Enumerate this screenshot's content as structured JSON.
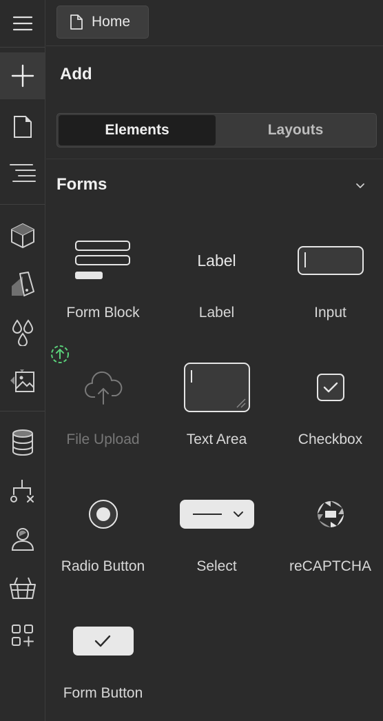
{
  "topbar": {
    "page_label": "Home"
  },
  "panel": {
    "title": "Add",
    "tabs": [
      {
        "label": "Elements",
        "active": true
      },
      {
        "label": "Layouts",
        "active": false
      }
    ],
    "section": {
      "title": "Forms",
      "expanded": true
    }
  },
  "elements": [
    {
      "label": "Form Block",
      "icon": "form-block-icon"
    },
    {
      "label": "Label",
      "icon": "label-preview",
      "preview_text": "Label"
    },
    {
      "label": "Input",
      "icon": "input-icon"
    },
    {
      "label": "File Upload",
      "icon": "cloud-upload-icon",
      "disabled": true
    },
    {
      "label": "Text Area",
      "icon": "text-area-icon"
    },
    {
      "label": "Checkbox",
      "icon": "checkbox-icon"
    },
    {
      "label": "Radio Button",
      "icon": "radio-button-icon"
    },
    {
      "label": "Select",
      "icon": "select-icon"
    },
    {
      "label": "reCAPTCHA",
      "icon": "recaptcha-icon"
    },
    {
      "label": "Form Button",
      "icon": "form-button-icon"
    }
  ],
  "rail": [
    "menu-icon",
    "add-icon",
    "pages-icon",
    "navigator-icon",
    "components-icon",
    "style-selectors-icon",
    "variables-icon",
    "assets-icon",
    "cms-icon",
    "logic-icon",
    "users-icon",
    "ecommerce-icon",
    "apps-icon"
  ],
  "colors": {
    "background": "#2b2b2b",
    "accent_green": "#5ad17a",
    "tile_light": "#e8e8e8"
  }
}
